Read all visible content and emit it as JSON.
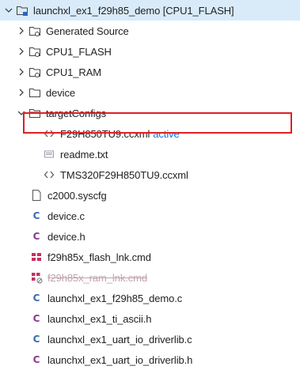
{
  "tree": {
    "root": {
      "label": "launchxl_ex1_f29h85_demo [CPU1_FLASH]",
      "expanded": true
    },
    "folders": [
      {
        "label": "Generated Source",
        "expanded": false
      },
      {
        "label": "CPU1_FLASH",
        "expanded": false
      },
      {
        "label": "CPU1_RAM",
        "expanded": false
      },
      {
        "label": "device",
        "expanded": false
      },
      {
        "label": "targetConfigs",
        "expanded": true
      }
    ],
    "target_files": [
      {
        "label": "F29H850TU9.ccxml",
        "tag": "active",
        "highlighted": true
      },
      {
        "label": "readme.txt"
      },
      {
        "label": "TMS320F29H850TU9.ccxml"
      }
    ],
    "files": [
      {
        "label": "c2000.syscfg",
        "icon": "doc-icon"
      },
      {
        "label": "device.c",
        "icon": "c-source-icon"
      },
      {
        "label": "device.h",
        "icon": "c-header-icon"
      },
      {
        "label": "f29h85x_flash_lnk.cmd",
        "icon": "cmd-file-icon"
      },
      {
        "label": "f29h85x_ram_lnk.cmd",
        "icon": "cmd-file-excluded-icon",
        "excluded": true
      },
      {
        "label": "launchxl_ex1_f29h85_demo.c",
        "icon": "c-source-icon"
      },
      {
        "label": "launchxl_ex1_ti_ascii.h",
        "icon": "c-header-icon"
      },
      {
        "label": "launchxl_ex1_uart_io_driverlib.c",
        "icon": "c-source-icon"
      },
      {
        "label": "launchxl_ex1_uart_io_driverlib.h",
        "icon": "c-header-icon"
      }
    ]
  },
  "colors": {
    "root_bg": "#d9ebf9",
    "active_tag": "#1e6fd1",
    "highlight_border": "#e02020",
    "excluded_text": "#c0a3ac"
  }
}
